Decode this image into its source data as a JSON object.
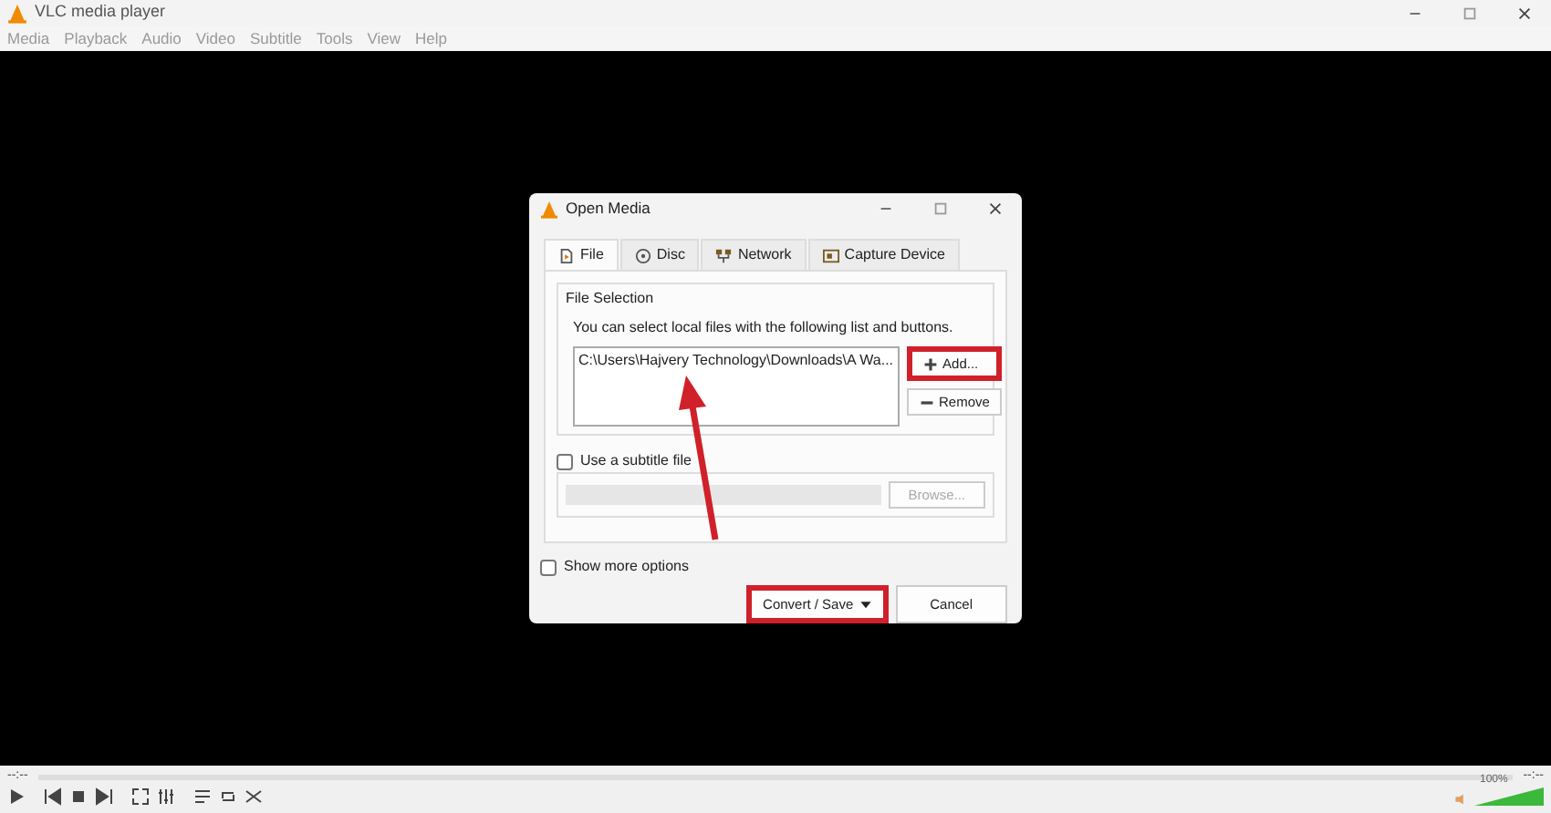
{
  "window": {
    "title": "VLC media player"
  },
  "menu": [
    "Media",
    "Playback",
    "Audio",
    "Video",
    "Subtitle",
    "Tools",
    "View",
    "Help"
  ],
  "dialog": {
    "title": "Open Media",
    "tabs": [
      {
        "label": "File",
        "selected": true,
        "kind": "file"
      },
      {
        "label": "Disc",
        "selected": false,
        "kind": "disc"
      },
      {
        "label": "Network",
        "selected": false,
        "kind": "network"
      },
      {
        "label": "Capture Device",
        "selected": false,
        "kind": "capture"
      }
    ],
    "file_selection": {
      "legend": "File Selection",
      "hint": "You can select local files with the following list and buttons.",
      "files": [
        "C:\\Users\\Hajvery Technology\\Downloads\\A Wa..."
      ],
      "buttons": [
        {
          "label": "Add...",
          "kind": "add",
          "highlighted": true
        },
        {
          "label": "Remove",
          "kind": "remove",
          "highlighted": false
        }
      ]
    },
    "subtitle": {
      "label": "Use a subtitle file",
      "checked": false,
      "browse": "Browse...",
      "disabled": true
    },
    "show_more": {
      "label": "Show more options",
      "checked": false
    },
    "buttons": [
      {
        "label": "Convert / Save",
        "kind": "split",
        "highlighted": true
      },
      {
        "label": "Cancel",
        "kind": "plain",
        "highlighted": false
      }
    ]
  },
  "player": {
    "elapsed": "--:--",
    "total": "--:--",
    "volume": {
      "reading": "100%",
      "level": 1.0
    }
  }
}
